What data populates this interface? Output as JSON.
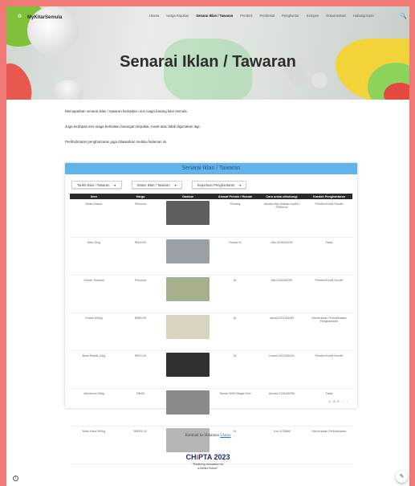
{
  "header": {
    "brand": "MyKitarSemula",
    "brand_logo": "recycle-logo-icon",
    "nav": [
      "Utama",
      "Harga Rujukan",
      "Senarai Iklan / Tawaran",
      "Pembeli",
      "Pembekal",
      "Penghantar",
      "Kempen",
      "Dokumentasi",
      "Hubungi kami"
    ],
    "active_nav": "Senarai Iklan / Tawaran",
    "search_icon": "search-icon"
  },
  "hero": {
    "title": "Senarai Iklan / Tawaran"
  },
  "intro": [
    "Memaparkan senarai iklan / tawaran berkaitan urus niaga barang kitar semula.",
    "Juga terdapat urus niaga berkaitan barangan terpakai, rosak atau tidak digunakan lagi.",
    "Perkhidmatan penghantaran juga ditawarkan melalui halaman ini."
  ],
  "card": {
    "title": "Senarai Iklan / Tawaran",
    "filters": [
      "Tarikh Iklan / Tawaran",
      "Status Iklan / Tawaran",
      "Keperluan Penghantaran"
    ],
    "columns": [
      "Item",
      "Harga",
      "Gambar",
      "Alamat Premis / Rumah",
      "Cara untuk dihubungi",
      "Kaedah Penghantaran"
    ],
    "rows": [
      {
        "item": "Mesin Basuh",
        "harga": "Percuma",
        "alamat": "Penang",
        "hubungi": "Ahmad http://wasap.my/601 2286xxxx",
        "penghantaran": "Pembeli Ambil Sendiri"
      },
      {
        "item": "Besi 20kg",
        "harga": "RM10.00",
        "alamat": "Cheras KL",
        "hubungi": "Abu 0135436789",
        "penghantaran": "Tiada"
      },
      {
        "item": "Kereta Terpakai",
        "harga": "Percuma",
        "alamat": "KL",
        "hubungi": "Mia 0126436789",
        "penghantaran": "Pembeli Ambil Sendiri"
      },
      {
        "item": "Kertas 500kg",
        "harga": "RM50.00",
        "alamat": "KL",
        "hubungi": "Jamal 0122264430",
        "penghantaran": "Memerlukan Perkhidmatan Penghantaran"
      },
      {
        "item": "Botol Plastik 10kg",
        "harga": "RM10.00",
        "alamat": "KL",
        "hubungi": "Kamal 0122264430",
        "penghantaran": "Pembeli Ambil Sendiri"
      },
      {
        "item": "Aluminium 30kg",
        "harga": "RM30",
        "alamat": "Taman SIMH Bagan Buir",
        "hubungi": "Ahmad 0126436789",
        "penghantaran": "Tiada"
      },
      {
        "item": "Botol Kaca 300kg",
        "harga": "RM300.00",
        "alamat": "KL",
        "hubungi": "Yun 0133866",
        "penghantaran": "Memerlukan Perkhidmatan"
      }
    ],
    "thumb_colors": [
      "#5e5e5e",
      "#9aa0a6",
      "#a6b08c",
      "#d8d2c0",
      "#303030",
      "#8a8a8a",
      "#b5b5b5"
    ],
    "pager": "1 - 8 / 9"
  },
  "footer": {
    "back_prefix": "Kembali ke Halaman",
    "back_link": "Utama",
    "chipta_prefix": "CH",
    "chipta_hi": "i",
    "chipta_suffix": "PTA 2023",
    "chipta_sub1": "\"Realizing Innovation for",
    "chipta_sub2": "a Better Future\""
  }
}
